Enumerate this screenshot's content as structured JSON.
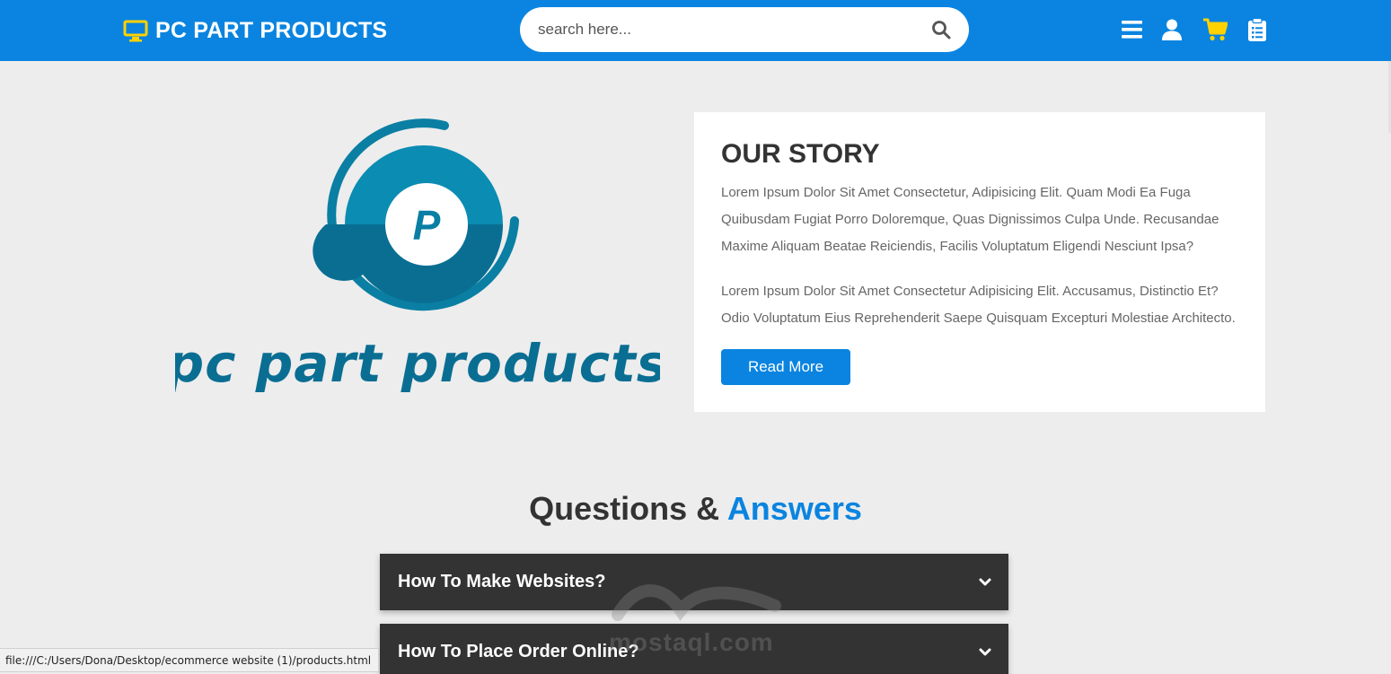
{
  "header": {
    "brand": "PC PART PRODUCTS",
    "search": {
      "placeholder": "search here...",
      "value": ""
    },
    "icons": [
      "menu-icon",
      "user-icon",
      "cart-icon",
      "clipboard-icon"
    ]
  },
  "about": {
    "logo_text": "pc part products",
    "logo_letter": "P",
    "title": "OUR STORY",
    "paragraphs": [
      [
        "Lorem Ipsum Dolor Sit Amet Consectetur, Adipisicing Elit. Quam Modi Ea Fuga",
        "Quibusdam Fugiat Porro Doloremque, Quas Dignissimos Culpa Unde. Recusandae",
        "Maxime Aliquam Beatae Reiciendis, Facilis Voluptatum Eligendi Nesciunt Ipsa?"
      ],
      [
        "Lorem Ipsum Dolor Sit Amet Consectetur Adipisicing Elit. Accusamus, Distinctio Et?",
        "Odio Voluptatum Eius Reprehenderit Saepe Quisquam Excepturi Molestiae Architecto."
      ]
    ],
    "button": "Read More"
  },
  "faq": {
    "heading": "Questions &",
    "heading_accent": "Answers",
    "items": [
      {
        "question": "How To Make Websites?"
      },
      {
        "question": "How To Place Order Online?"
      }
    ]
  },
  "statusbar": {
    "url": "file:///C:/Users/Dona/Desktop/ecommerce website (1)/products.html"
  },
  "watermark": {
    "text": "mostaql.com"
  },
  "colors": {
    "primary": "#0a84e0",
    "accent_yellow": "#ffd200",
    "logo_teal": "#0a7fa3",
    "dark": "#333333"
  }
}
